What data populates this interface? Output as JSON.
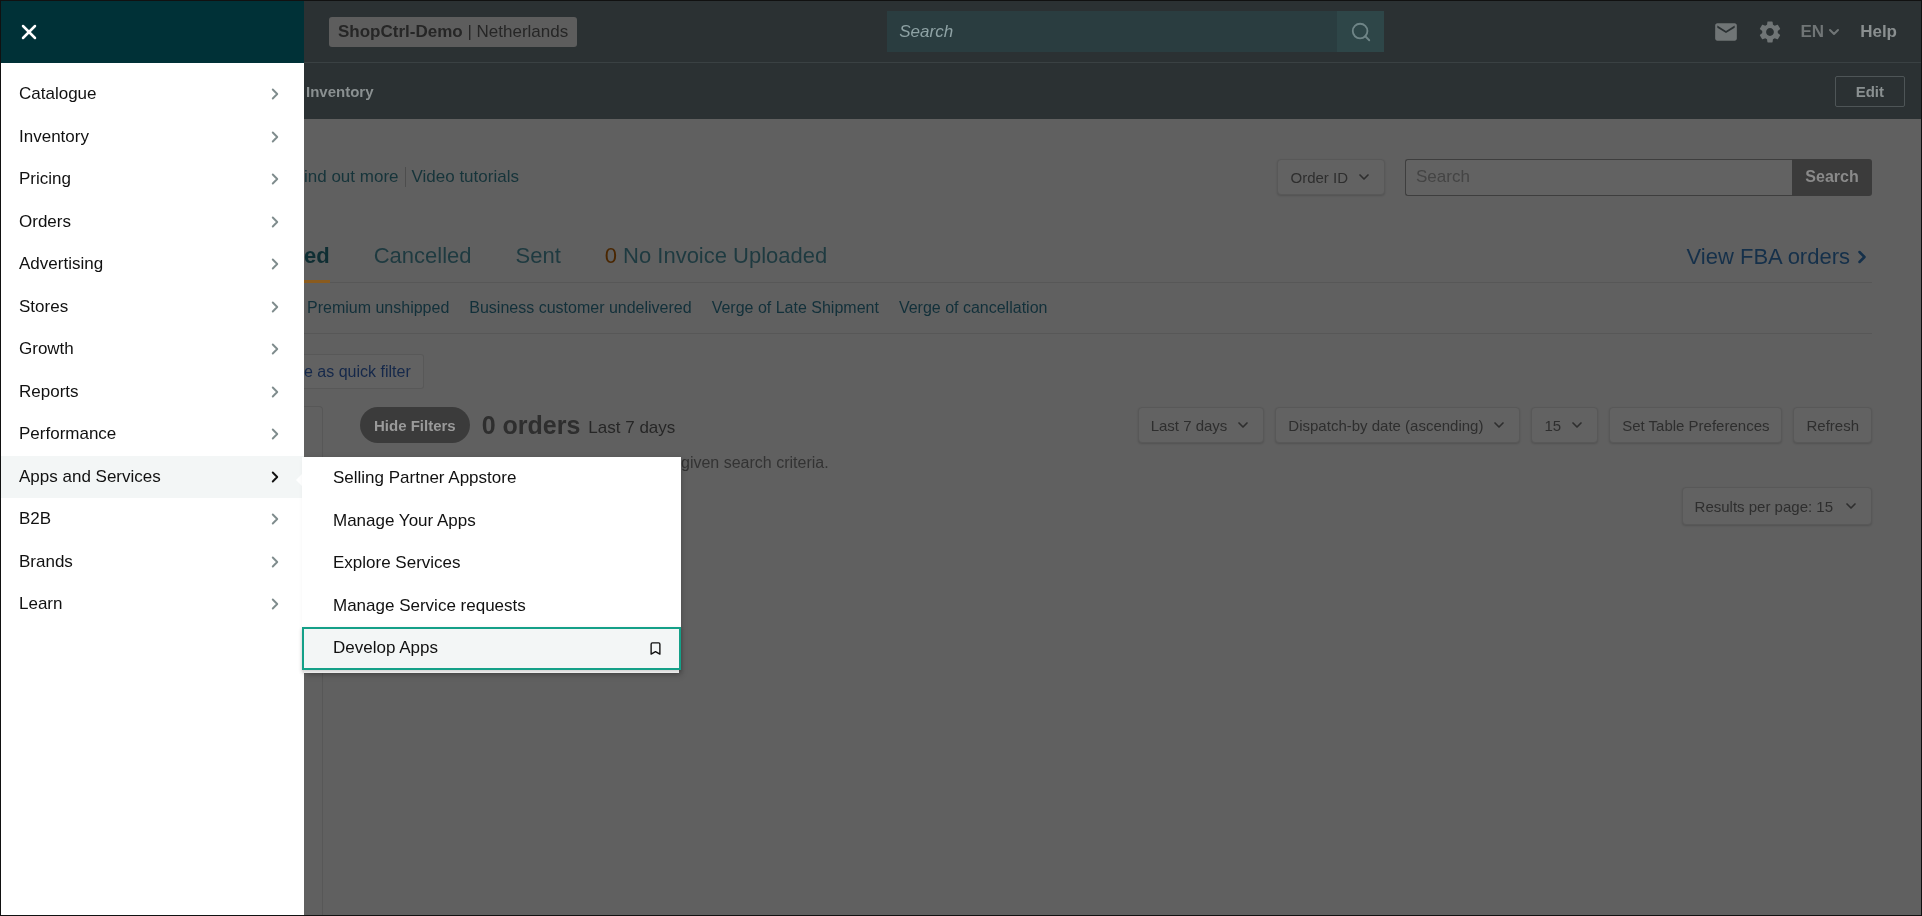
{
  "topbar": {
    "store": {
      "name": "ShopCtrl-Demo",
      "separator": "|",
      "region": "Netherlands"
    },
    "search": {
      "placeholder": "Search"
    },
    "language": "EN",
    "help": "Help"
  },
  "nav_bar": {
    "breadcrumb": "Inventory",
    "edit": "Edit"
  },
  "drawer": {
    "items": [
      {
        "label": "Catalogue",
        "selected": false
      },
      {
        "label": "Inventory",
        "selected": false
      },
      {
        "label": "Pricing",
        "selected": false
      },
      {
        "label": "Orders",
        "selected": false
      },
      {
        "label": "Advertising",
        "selected": false
      },
      {
        "label": "Stores",
        "selected": false
      },
      {
        "label": "Growth",
        "selected": false
      },
      {
        "label": "Reports",
        "selected": false
      },
      {
        "label": "Performance",
        "selected": false
      },
      {
        "label": "Apps and Services",
        "selected": true
      },
      {
        "label": "B2B",
        "selected": false
      },
      {
        "label": "Brands",
        "selected": false
      },
      {
        "label": "Learn",
        "selected": false
      }
    ],
    "submenu": [
      {
        "label": "Selling Partner Appstore",
        "selected": false
      },
      {
        "label": "Manage Your Apps",
        "selected": false
      },
      {
        "label": "Explore Services",
        "selected": false
      },
      {
        "label": "Manage Service requests",
        "selected": false
      },
      {
        "label": "Develop Apps",
        "selected": true
      }
    ]
  },
  "page": {
    "help_links": [
      "ind out more",
      "Video tutorials"
    ],
    "order_search": {
      "scope": "Order ID",
      "placeholder": "Search",
      "button": "Search"
    },
    "tabs": [
      {
        "label": "ed",
        "selected": true
      },
      {
        "label": "Cancelled",
        "selected": false
      },
      {
        "label": "Sent",
        "selected": false
      },
      {
        "count": "0",
        "label": "No Invoice Uploaded",
        "selected": false
      }
    ],
    "view_fba": "View FBA orders",
    "quick_filters": [
      "Premium unshipped",
      "Business customer undelivered",
      "Verge of Late Shipment",
      "Verge of cancellation"
    ],
    "save_filter": "e as quick filter",
    "hide_filters": "Hide Filters",
    "orders_count": "0 orders",
    "period": "Last 7 days",
    "controls": [
      {
        "kind": "dropdown",
        "label": "Last 7 days"
      },
      {
        "kind": "dropdown",
        "label": "Dispatch-by date (ascending)"
      },
      {
        "kind": "dropdown",
        "label": "15"
      },
      {
        "kind": "button",
        "label": "Set Table Preferences"
      },
      {
        "kind": "button",
        "label": "Refresh"
      }
    ],
    "message": "given search criteria.",
    "results_per_page": "Results per page: 15"
  }
}
